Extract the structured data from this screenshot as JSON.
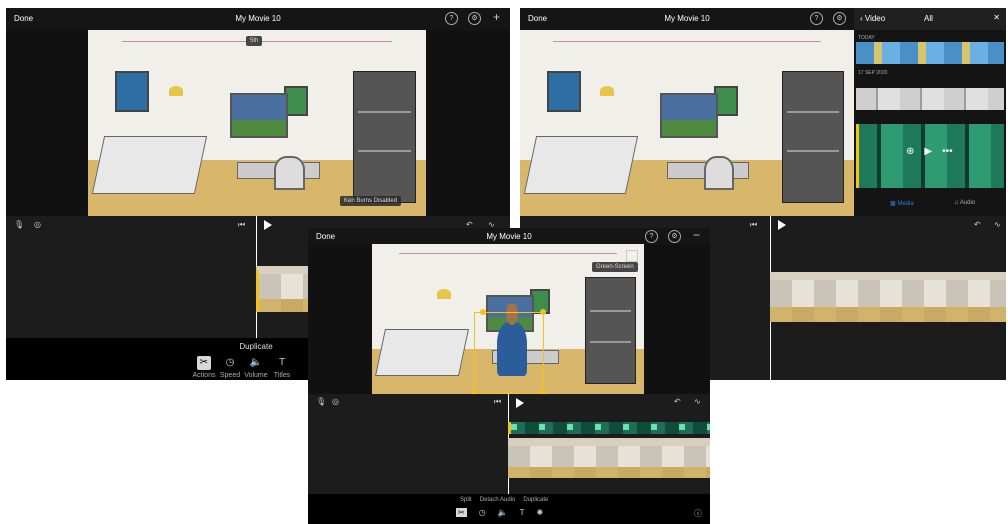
{
  "left_shot": {
    "done_label": "Done",
    "title": "My Movie 10",
    "top_badge": "5th",
    "ken_burns_label": "Ken Burns Disabled",
    "action_label": "Duplicate",
    "tools": [
      {
        "icon": "scissors-icon",
        "label": "Actions"
      },
      {
        "icon": "speed-icon",
        "label": "Speed"
      },
      {
        "icon": "volume-icon",
        "label": "Volume"
      },
      {
        "icon": "titles-icon",
        "label": "Titles"
      }
    ]
  },
  "right_shot": {
    "done_label": "Done",
    "title": "My Movie 10",
    "browser": {
      "back_label": "Video",
      "filter_label": "All",
      "section_today": "TODAY",
      "section_date": "17 SEP 2020",
      "tab_media": "Media",
      "tab_audio": "Audio"
    }
  },
  "center_shot": {
    "done_label": "Done",
    "title": "My Movie 10",
    "overlay_chip": "Green-Screen",
    "actions": [
      "Split",
      "Detach Audio",
      "Duplicate"
    ]
  },
  "colors": {
    "accent": "#f2c21b",
    "background": "#000000",
    "link_blue": "#2f7ddc"
  }
}
